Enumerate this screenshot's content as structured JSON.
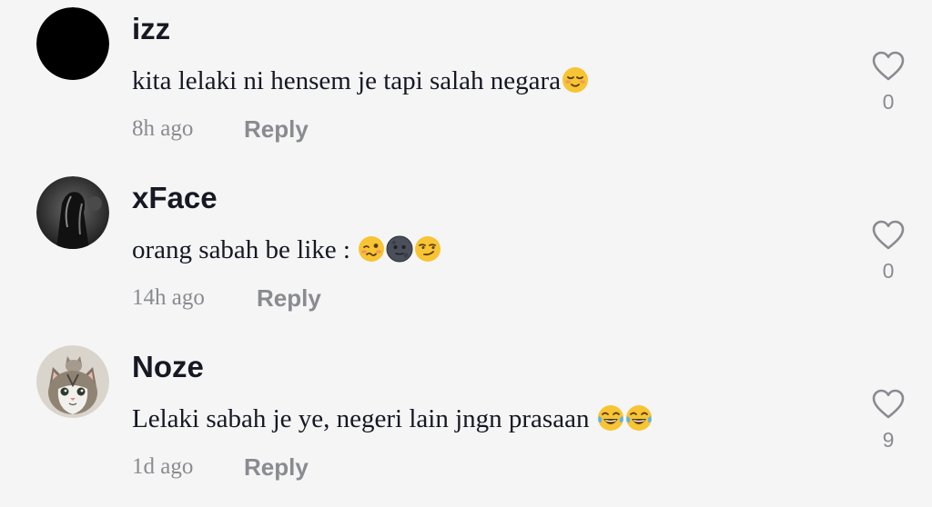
{
  "comments": [
    {
      "username": "izz",
      "text": "kita lelaki ni hensem je tapi salah negara",
      "emojis": [
        "relieved-face"
      ],
      "time": "8h ago",
      "reply_label": "Reply",
      "likes": "0",
      "avatar": "black-circle-avatar"
    },
    {
      "username": "xFace",
      "text": "orang sabah be like : ",
      "emojis": [
        "woozy-face",
        "new-moon-face",
        "smirking-face"
      ],
      "time": "14h ago",
      "reply_label": "Reply",
      "likes": "0",
      "avatar": "dark-photo-avatar"
    },
    {
      "username": "Noze",
      "text": "Lelaki sabah je ye, negeri lain jngn prasaan ",
      "emojis": [
        "tears-of-joy-face",
        "tears-of-joy-face"
      ],
      "time": "1d ago",
      "reply_label": "Reply",
      "likes": "9",
      "avatar": "cat-photo-avatar"
    }
  ],
  "colors": {
    "background": "#f5f5f5",
    "username": "#161823",
    "meta": "#8a8b91",
    "emoji_yellow": "#f7c433"
  }
}
